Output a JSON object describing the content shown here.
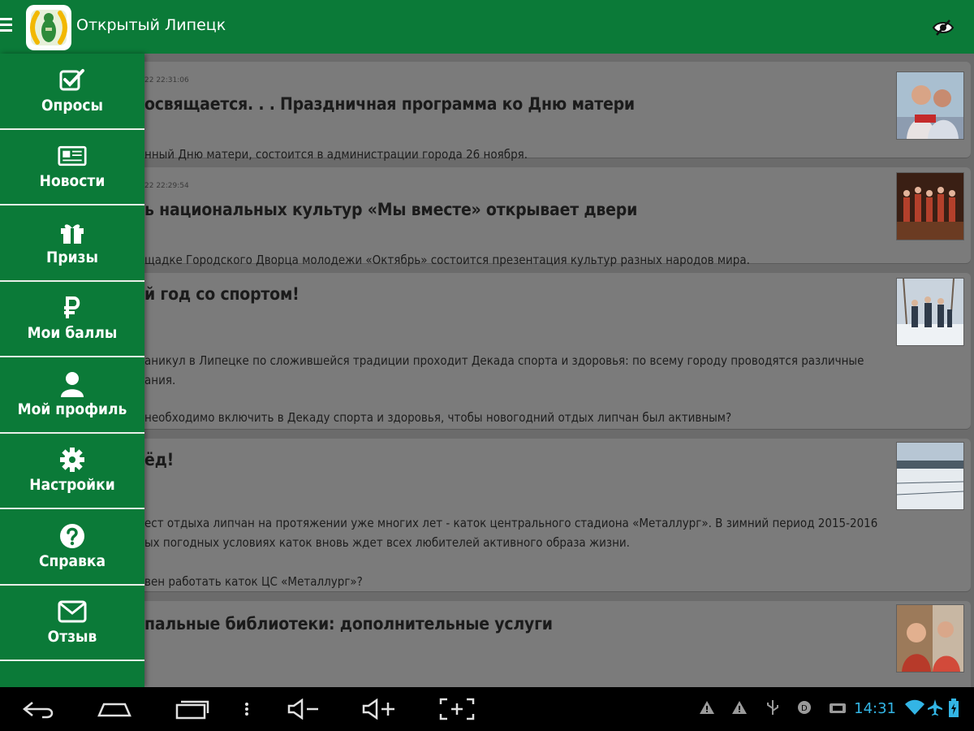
{
  "app": {
    "title": "Открытый Липецк"
  },
  "drawer": {
    "items": [
      {
        "label": "Опросы",
        "icon": "checkbox-icon"
      },
      {
        "label": "Новости",
        "icon": "newspaper-icon"
      },
      {
        "label": "Призы",
        "icon": "gift-icon"
      },
      {
        "label": "Мои баллы",
        "icon": "ruble-icon"
      },
      {
        "label": "Мой профиль",
        "icon": "user-icon"
      },
      {
        "label": "Настройки",
        "icon": "gear-icon"
      },
      {
        "label": "Справка",
        "icon": "help-icon"
      },
      {
        "label": "Отзыв",
        "icon": "envelope-icon"
      }
    ]
  },
  "feed": {
    "cards": [
      {
        "date": "22 22:31:06",
        "title": "освящается. . . Праздничная программа ко Дню матери",
        "desc": "нный Дню матери, состоится в администрации города 26 ноября."
      },
      {
        "date": "22 22:29:54",
        "title": "ь национальных культур «Мы вместе» открывает двери",
        "desc": "щадке Городского Дворца молодежи «Октябрь» состоится презентация культур разных народов мира."
      },
      {
        "title": "й год со спортом!",
        "desc": "аникул в Липецке по сложившейся традиции проходит Декада спорта и здоровья: по всему городу проводятся различные",
        "desc2": "ания.",
        "desc3": "необходимо включить в Декаду спорта и здоровья, чтобы новогодний отдых липчан был активным?"
      },
      {
        "title": "ёд!",
        "desc": "ест отдыха липчан на протяжении уже многих лет - каток центрального стадиона «Металлург». В зимний период 2015-2016",
        "desc2": "ых погодных условиях каток вновь ждет всех любителей активного образа жизни.",
        "desc3": "вен работать каток ЦС «Металлург»?"
      },
      {
        "title": "пальные библиотеки: дополнительные услуги"
      }
    ]
  },
  "system": {
    "clock": "14:31"
  }
}
